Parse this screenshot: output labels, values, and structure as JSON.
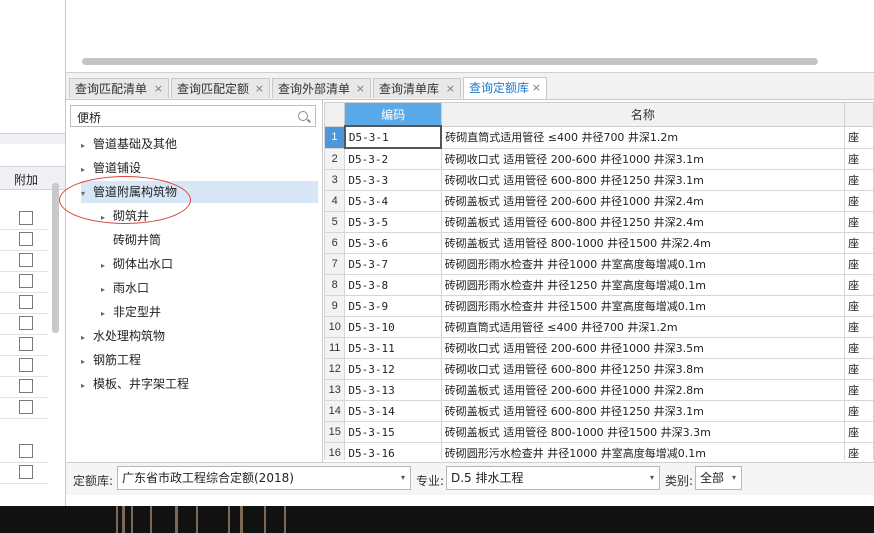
{
  "left_panel": {
    "header_label": "附加",
    "checkbox_rows": 12
  },
  "tabs": [
    {
      "label": "查询匹配清单",
      "active": false
    },
    {
      "label": "查询匹配定额",
      "active": false
    },
    {
      "label": "查询外部清单",
      "active": false
    },
    {
      "label": "查询清单库",
      "active": false
    },
    {
      "label": "查询定额库",
      "active": true
    }
  ],
  "tab_close_glyph": "×",
  "search": {
    "value": "便桥",
    "icon": "search-icon"
  },
  "tree": [
    {
      "label": "管道基础及其他",
      "level": 0,
      "expander": "▸"
    },
    {
      "label": "管道铺设",
      "level": 0,
      "expander": "▸"
    },
    {
      "label": "管道附属构筑物",
      "level": 0,
      "expander": "▾",
      "selected": true
    },
    {
      "label": "砌筑井",
      "level": 1,
      "expander": "▸"
    },
    {
      "label": "砖砌井筒",
      "level": 1,
      "expander": ""
    },
    {
      "label": "砌体出水口",
      "level": 1,
      "expander": "▸"
    },
    {
      "label": "雨水口",
      "level": 1,
      "expander": "▸"
    },
    {
      "label": "非定型井",
      "level": 1,
      "expander": "▸"
    },
    {
      "label": "水处理构筑物",
      "level": 0,
      "expander": "▸"
    },
    {
      "label": "钢筋工程",
      "level": 0,
      "expander": "▸"
    },
    {
      "label": "模板、井字架工程",
      "level": 0,
      "expander": "▸"
    }
  ],
  "grid": {
    "columns": {
      "code": "编码",
      "name": "名称"
    },
    "rows": [
      {
        "num": "1",
        "code": "D5-3-1",
        "name": "砖砌直筒式适用管径 ≤400 井径700 井深1.2m",
        "extra": "座"
      },
      {
        "num": "2",
        "code": "D5-3-2",
        "name": "砖砌收口式 适用管径 200-600 井径1000 井深3.1m",
        "extra": "座"
      },
      {
        "num": "3",
        "code": "D5-3-3",
        "name": "砖砌收口式 适用管径 600-800 井径1250 井深3.1m",
        "extra": "座"
      },
      {
        "num": "4",
        "code": "D5-3-4",
        "name": "砖砌盖板式 适用管径 200-600 井径1000 井深2.4m",
        "extra": "座"
      },
      {
        "num": "5",
        "code": "D5-3-5",
        "name": "砖砌盖板式 适用管径 600-800 井径1250 井深2.4m",
        "extra": "座"
      },
      {
        "num": "6",
        "code": "D5-3-6",
        "name": "砖砌盖板式 适用管径 800-1000 井径1500 井深2.4m",
        "extra": "座"
      },
      {
        "num": "7",
        "code": "D5-3-7",
        "name": "砖砌圆形雨水检查井 井径1000 井室高度每增减0.1m",
        "extra": "座"
      },
      {
        "num": "8",
        "code": "D5-3-8",
        "name": "砖砌圆形雨水检查井 井径1250 井室高度每增减0.1m",
        "extra": "座"
      },
      {
        "num": "9",
        "code": "D5-3-9",
        "name": "砖砌圆形雨水检查井 井径1500 井室高度每增减0.1m",
        "extra": "座"
      },
      {
        "num": "10",
        "code": "D5-3-10",
        "name": "砖砌直筒式适用管径 ≤400 井径700 井深1.2m",
        "extra": "座"
      },
      {
        "num": "11",
        "code": "D5-3-11",
        "name": "砖砌收口式 适用管径 200-600 井径1000 井深3.5m",
        "extra": "座"
      },
      {
        "num": "12",
        "code": "D5-3-12",
        "name": "砖砌收口式 适用管径 600-800 井径1250 井深3.8m",
        "extra": "座"
      },
      {
        "num": "13",
        "code": "D5-3-13",
        "name": "砖砌盖板式 适用管径 200-600 井径1000 井深2.8m",
        "extra": "座"
      },
      {
        "num": "14",
        "code": "D5-3-14",
        "name": "砖砌盖板式 适用管径 600-800 井径1250 井深3.1m",
        "extra": "座"
      },
      {
        "num": "15",
        "code": "D5-3-15",
        "name": "砖砌盖板式 适用管径 800-1000 井径1500 井深3.3m",
        "extra": "座"
      },
      {
        "num": "16",
        "code": "D5-3-16",
        "name": "砖砌圆形污水检查井 井径1000 井室高度每增减0.1m",
        "extra": "座"
      }
    ]
  },
  "filters": {
    "library_label": "定额库:",
    "library_value": "广东省市政工程综合定额(2018)",
    "specialty_label": "专业:",
    "specialty_value": "D.5 排水工程",
    "category_label": "类别:",
    "category_value": "全部",
    "dropdown_glyph": "▾"
  },
  "colors": {
    "accent": "#1f78c8",
    "header_blue": "#5aa9e8",
    "annotation_red": "#d9463b"
  }
}
